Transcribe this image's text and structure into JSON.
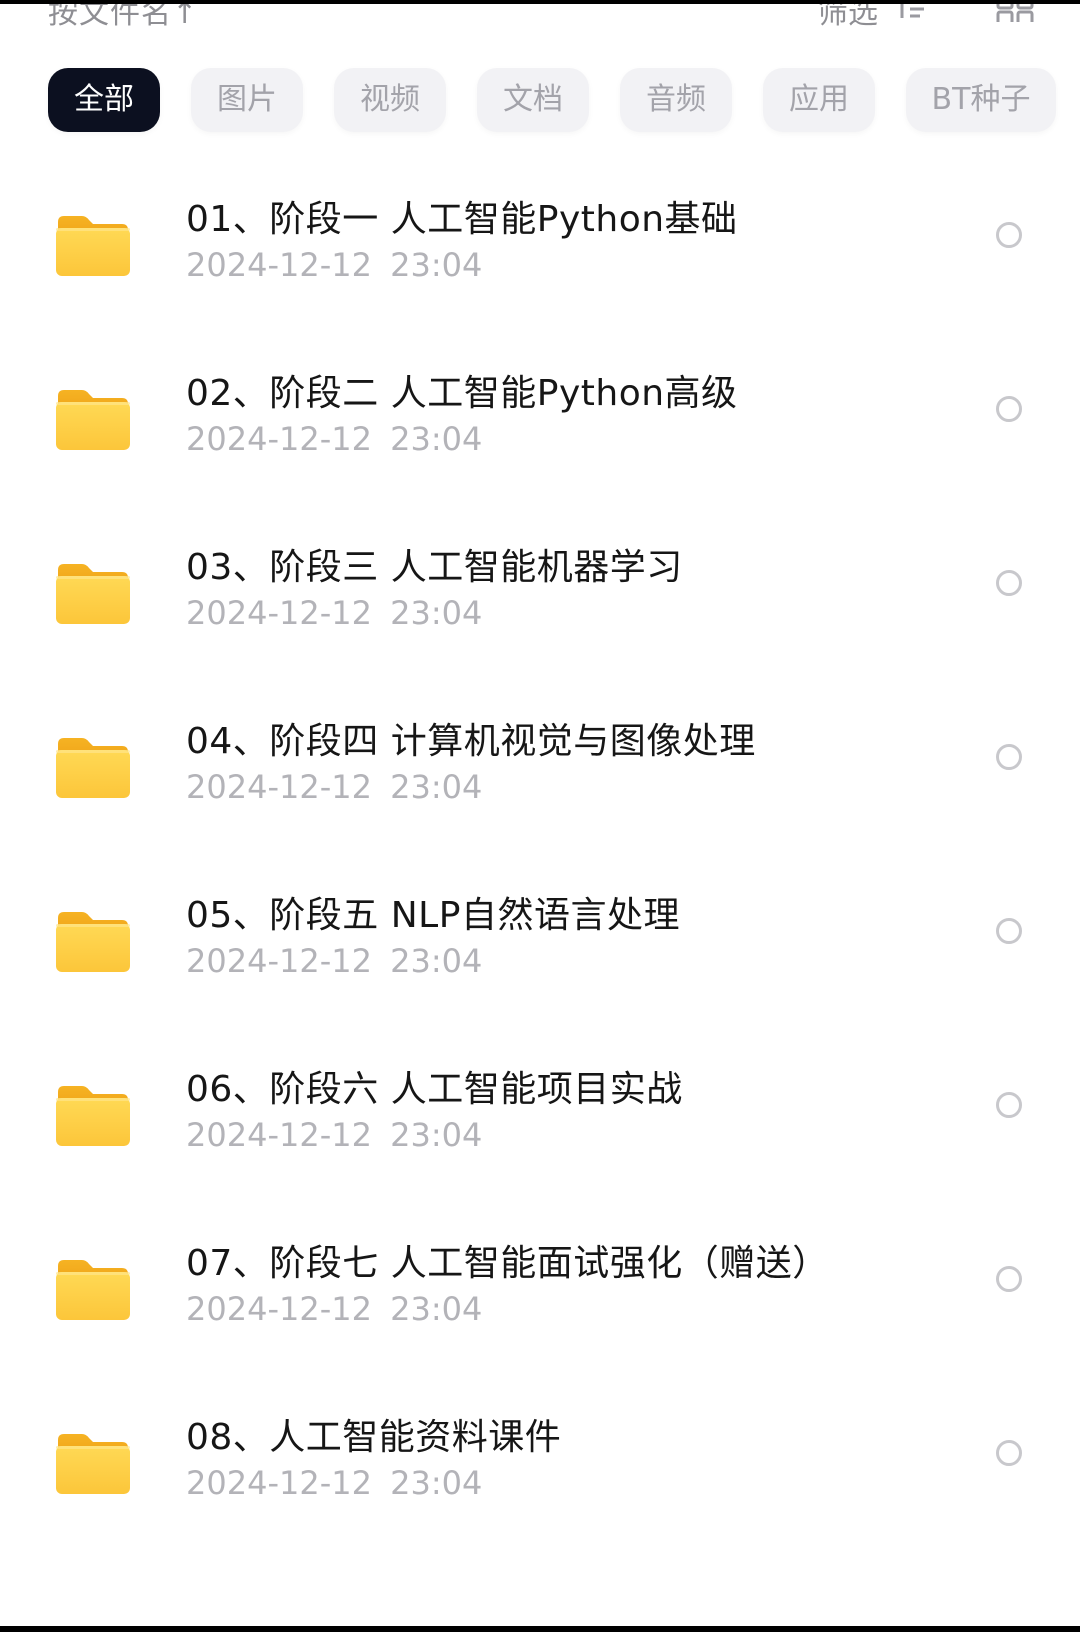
{
  "header": {
    "sort_label": "按文件名↑",
    "filter_label": "筛选"
  },
  "tabs": [
    {
      "label": "全部",
      "active": true
    },
    {
      "label": "图片",
      "active": false
    },
    {
      "label": "视频",
      "active": false
    },
    {
      "label": "文档",
      "active": false
    },
    {
      "label": "音频",
      "active": false
    },
    {
      "label": "应用",
      "active": false
    },
    {
      "label": "BT种子",
      "active": false
    }
  ],
  "files": [
    {
      "name": "01、阶段一 人工智能Python基础",
      "date": "2024-12-12 23:04",
      "icon": "folder-icon"
    },
    {
      "name": "02、阶段二 人工智能Python高级",
      "date": "2024-12-12 23:04",
      "icon": "folder-icon"
    },
    {
      "name": "03、阶段三 人工智能机器学习",
      "date": "2024-12-12 23:04",
      "icon": "folder-icon"
    },
    {
      "name": "04、阶段四 计算机视觉与图像处理",
      "date": "2024-12-12 23:04",
      "icon": "folder-icon"
    },
    {
      "name": "05、阶段五 NLP自然语言处理",
      "date": "2024-12-12 23:04",
      "icon": "folder-icon"
    },
    {
      "name": "06、阶段六 人工智能项目实战",
      "date": "2024-12-12 23:04",
      "icon": "folder-icon"
    },
    {
      "name": "07、阶段七 人工智能面试强化（赠送）",
      "date": "2024-12-12 23:04",
      "icon": "folder-icon"
    },
    {
      "name": "08、人工智能资料课件",
      "date": "2024-12-12 23:04",
      "icon": "folder-icon"
    }
  ],
  "colors": {
    "folder": "#fcc63a",
    "active_tab": "#0c1020",
    "inactive_tab_bg": "#f2f2f5",
    "date_text": "#b3b3b8"
  }
}
